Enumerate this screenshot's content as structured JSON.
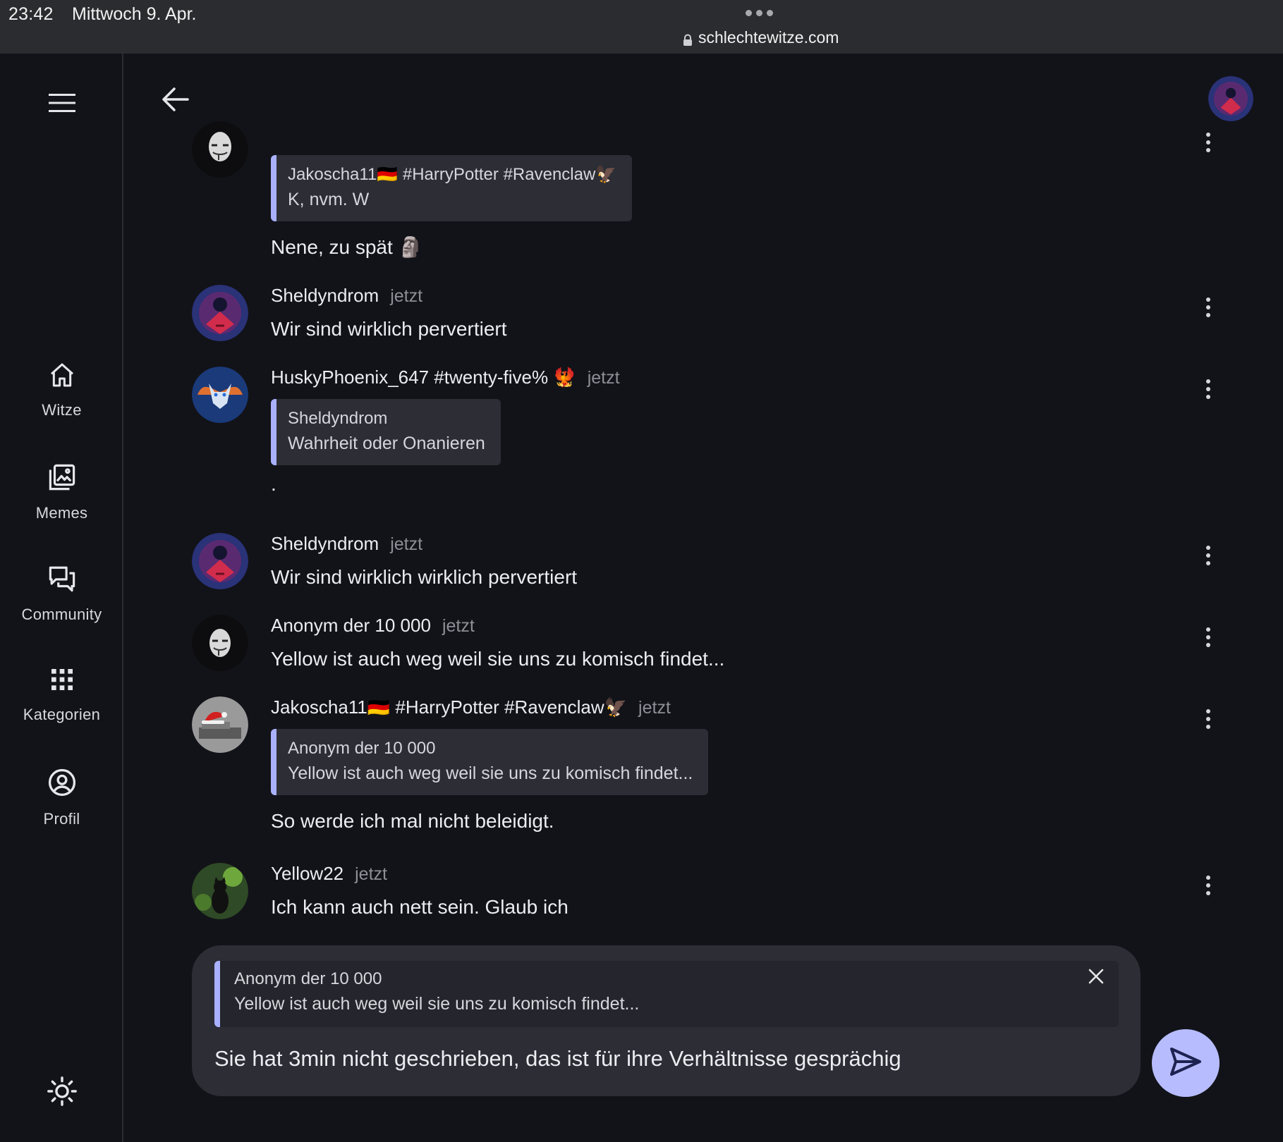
{
  "status_bar": {
    "time": "23:42",
    "date": "Mittwoch 9. Apr.",
    "url": "schlechtewitze.com"
  },
  "sidebar": {
    "items": [
      {
        "label": "Witze",
        "icon": "home-icon"
      },
      {
        "label": "Memes",
        "icon": "images-icon"
      },
      {
        "label": "Community",
        "icon": "chat-icon"
      },
      {
        "label": "Kategorien",
        "icon": "grid-icon"
      },
      {
        "label": "Profil",
        "icon": "profile-icon"
      }
    ],
    "theme_icon": "sun-icon",
    "menu_icon": "hamburger-icon"
  },
  "header": {
    "back_icon": "arrow-left-icon"
  },
  "messages": [
    {
      "quote": {
        "author": "Jakoscha11🇩🇪 #HarryPotter #Ravenclaw🦅",
        "text": "K, nvm. W"
      },
      "text": "Nene, zu spät 🗿"
    },
    {
      "author": "Sheldyndrom",
      "time": "jetzt",
      "text": "Wir sind wirklich pervertiert"
    },
    {
      "author": "HuskyPhoenix_647 #twenty-five% 🐦‍🔥",
      "time": "jetzt",
      "quote": {
        "author": "Sheldyndrom",
        "text": "Wahrheit oder Onanieren"
      },
      "text": "."
    },
    {
      "author": "Sheldyndrom",
      "time": "jetzt",
      "text": "Wir sind wirklich wirklich pervertiert"
    },
    {
      "author": "Anonym der 10 000",
      "time": "jetzt",
      "text": "Yellow ist auch weg weil sie uns zu komisch findet..."
    },
    {
      "author": "Jakoscha11🇩🇪 #HarryPotter #Ravenclaw🦅",
      "time": "jetzt",
      "quote": {
        "author": "Anonym der 10 000",
        "text": "Yellow ist auch weg weil sie uns zu komisch findet..."
      },
      "text": "So werde ich mal nicht beleidigt."
    },
    {
      "author": "Yellow22",
      "time": "jetzt",
      "text": "Ich kann auch nett sein. Glaub ich"
    }
  ],
  "composer": {
    "reply": {
      "author": "Anonym der 10 000",
      "text": "Yellow ist auch weg weil sie uns zu komisch findet..."
    },
    "value": "Sie hat 3min nicht geschrieben, das ist für ihre Verhältnisse gesprächig",
    "send_icon": "send-icon",
    "close_icon": "close-icon"
  },
  "colors": {
    "background": "#121319",
    "accent": "#a9b1ff",
    "send_button": "#b7bcff",
    "bubble": "#2c2d35"
  }
}
